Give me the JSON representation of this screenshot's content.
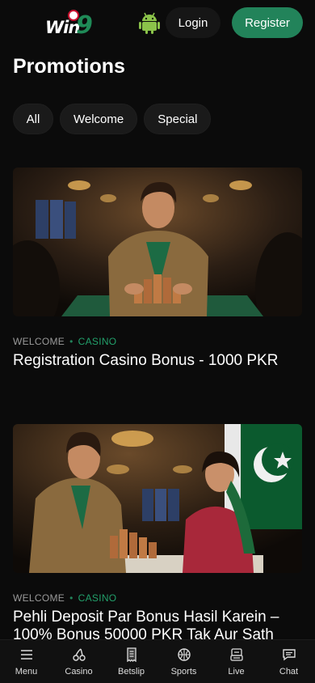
{
  "header": {
    "logo_text": "Win",
    "logo_number": "9",
    "login_label": "Login",
    "register_label": "Register",
    "android_icon": "android-icon"
  },
  "page_title": "Promotions",
  "filters": [
    {
      "label": "All"
    },
    {
      "label": "Welcome"
    },
    {
      "label": "Special"
    }
  ],
  "promos": [
    {
      "category1": "WELCOME",
      "category2": "CASINO",
      "title": "Registration Casino Bonus - 1000 PKR"
    },
    {
      "category1": "WELCOME",
      "category2": "CASINO",
      "title": "Pehli Deposit Par Bonus Hasil Karein – 100% Bonus 50000 PKR Tak Aur Sath"
    }
  ],
  "bottom_nav": [
    {
      "label": "Menu",
      "icon": "menu-icon"
    },
    {
      "label": "Casino",
      "icon": "cherries-icon"
    },
    {
      "label": "Betslip",
      "icon": "receipt-icon"
    },
    {
      "label": "Sports",
      "icon": "basketball-icon"
    },
    {
      "label": "Live",
      "icon": "live-tv-icon"
    },
    {
      "label": "Chat",
      "icon": "chat-icon"
    }
  ],
  "colors": {
    "accent_green": "#22835a",
    "background": "#0b0b0b"
  }
}
